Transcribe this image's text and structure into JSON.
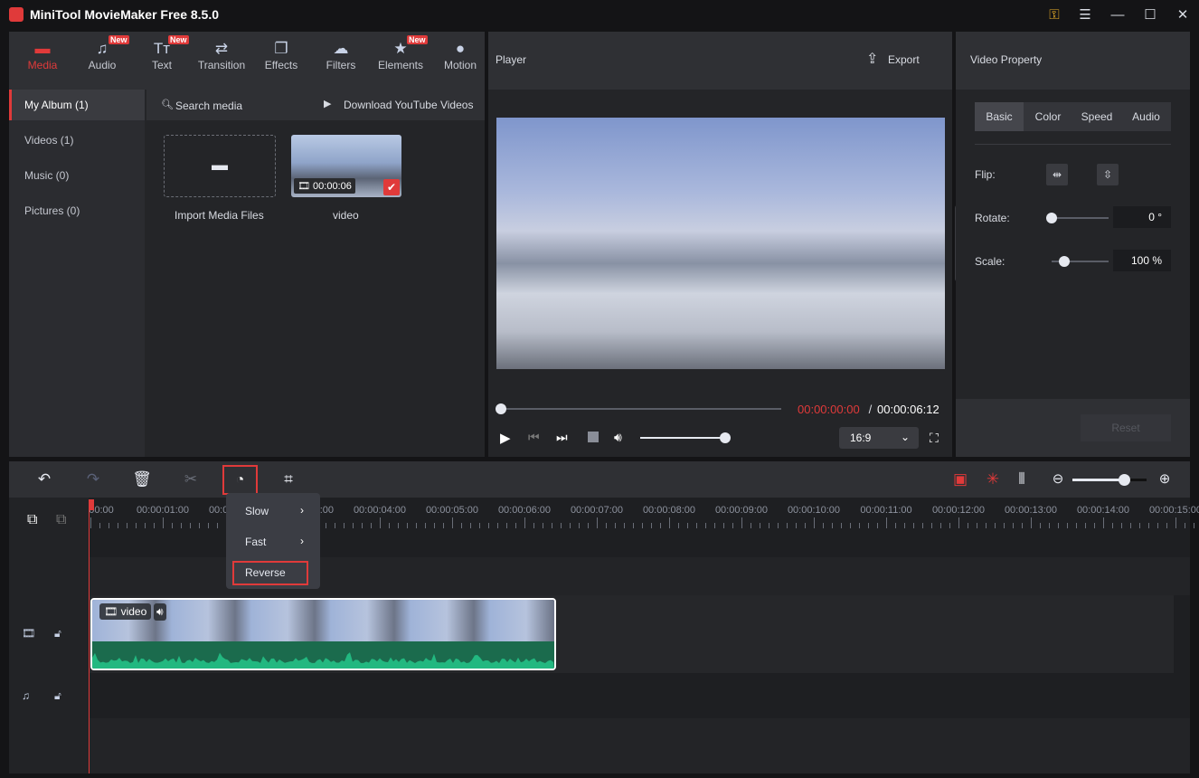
{
  "app": {
    "title": "MiniTool MovieMaker Free 8.5.0"
  },
  "media_tabs": [
    {
      "label": "Media",
      "icon": "folder-icon",
      "new": false
    },
    {
      "label": "Audio",
      "icon": "music-icon",
      "new": true
    },
    {
      "label": "Text",
      "icon": "text-icon",
      "new": true
    },
    {
      "label": "Transition",
      "icon": "transition-icon",
      "new": false
    },
    {
      "label": "Effects",
      "icon": "effects-icon",
      "new": false
    },
    {
      "label": "Filters",
      "icon": "filters-icon",
      "new": false
    },
    {
      "label": "Elements",
      "icon": "elements-icon",
      "new": true
    },
    {
      "label": "Motion",
      "icon": "motion-icon",
      "new": false
    }
  ],
  "new_badge": "New",
  "album": [
    {
      "label": "My Album (1)"
    },
    {
      "label": "Videos (1)"
    },
    {
      "label": "Music (0)"
    },
    {
      "label": "Pictures (0)"
    }
  ],
  "media": {
    "search": "Search media",
    "download": "Download YouTube Videos",
    "import_label": "Import Media Files",
    "video_name": "video",
    "video_duration": "00:00:06"
  },
  "player": {
    "title": "Player",
    "export": "Export",
    "current_time": "00:00:00:00",
    "separator": " / ",
    "total_time": "00:00:06:12",
    "aspect": "16:9",
    "progress": 0,
    "volume": 0.9
  },
  "property": {
    "title": "Video Property",
    "tabs": [
      "Basic",
      "Color",
      "Speed",
      "Audio"
    ],
    "flip": "Flip:",
    "rotate": "Rotate:",
    "rotate_value": "0 °",
    "scale": "Scale:",
    "scale_value": "100 %",
    "reset": "Reset",
    "rotate_fraction": 0,
    "scale_fraction": 0.22
  },
  "timeline": {
    "ruler": [
      "00:00",
      "00:00:01:00",
      "00:00:02:00",
      "00:00:03:00",
      "00:00:04:00",
      "00:00:05:00",
      "00:00:06:00",
      "00:00:07:00",
      "00:00:08:00",
      "00:00:09:00",
      "00:00:10:00",
      "00:00:11:00",
      "00:00:12:00",
      "00:00:13:00",
      "00:00:14:00",
      "00:00:15:00"
    ],
    "clip_label": "video",
    "zoom_fraction": 0.7
  },
  "speed_menu": {
    "items": [
      "Slow",
      "Fast",
      "Reverse"
    ]
  },
  "colors": {
    "accent": "#e03a3a",
    "audio_wave": "#22b880"
  }
}
